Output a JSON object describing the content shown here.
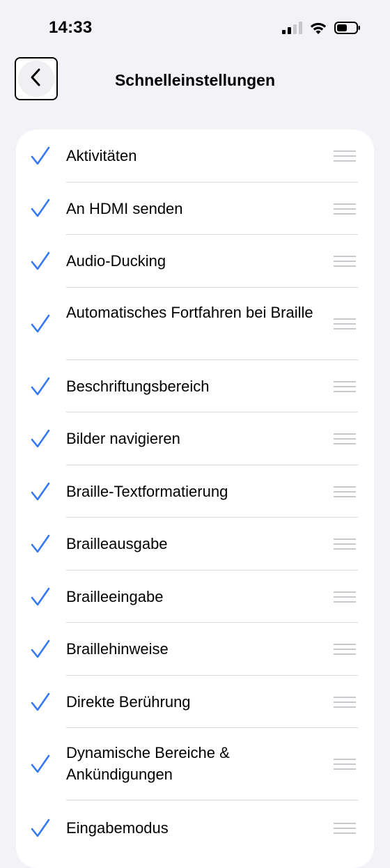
{
  "status_bar": {
    "time": "14:33",
    "icons": [
      "cellular-signal-icon",
      "wifi-icon",
      "battery-icon"
    ]
  },
  "nav": {
    "back_icon": "chevron-left-icon",
    "title": "Schnelleinstellungen"
  },
  "colors": {
    "accent": "#3478f6",
    "background": "#f2f2f7",
    "card": "#ffffff",
    "handle": "#c7c7cc"
  },
  "list": {
    "items": [
      {
        "label": "Aktivitäten",
        "checked": true
      },
      {
        "label": "An HDMI senden",
        "checked": true
      },
      {
        "label": "Audio-Ducking",
        "checked": true
      },
      {
        "label": "Automatisches Fortfahren bei Braille",
        "checked": true
      },
      {
        "label": "Beschriftungsbereich",
        "checked": true
      },
      {
        "label": "Bilder navigieren",
        "checked": true
      },
      {
        "label": "Braille-Textformatierung",
        "checked": true
      },
      {
        "label": "Brailleausgabe",
        "checked": true
      },
      {
        "label": "Brailleeingabe",
        "checked": true
      },
      {
        "label": "Braillehinweise",
        "checked": true
      },
      {
        "label": "Direkte Berührung",
        "checked": true
      },
      {
        "label": "Dynamische Bereiche & Ankündigungen",
        "checked": true
      },
      {
        "label": "Eingabemodus",
        "checked": true
      }
    ]
  }
}
